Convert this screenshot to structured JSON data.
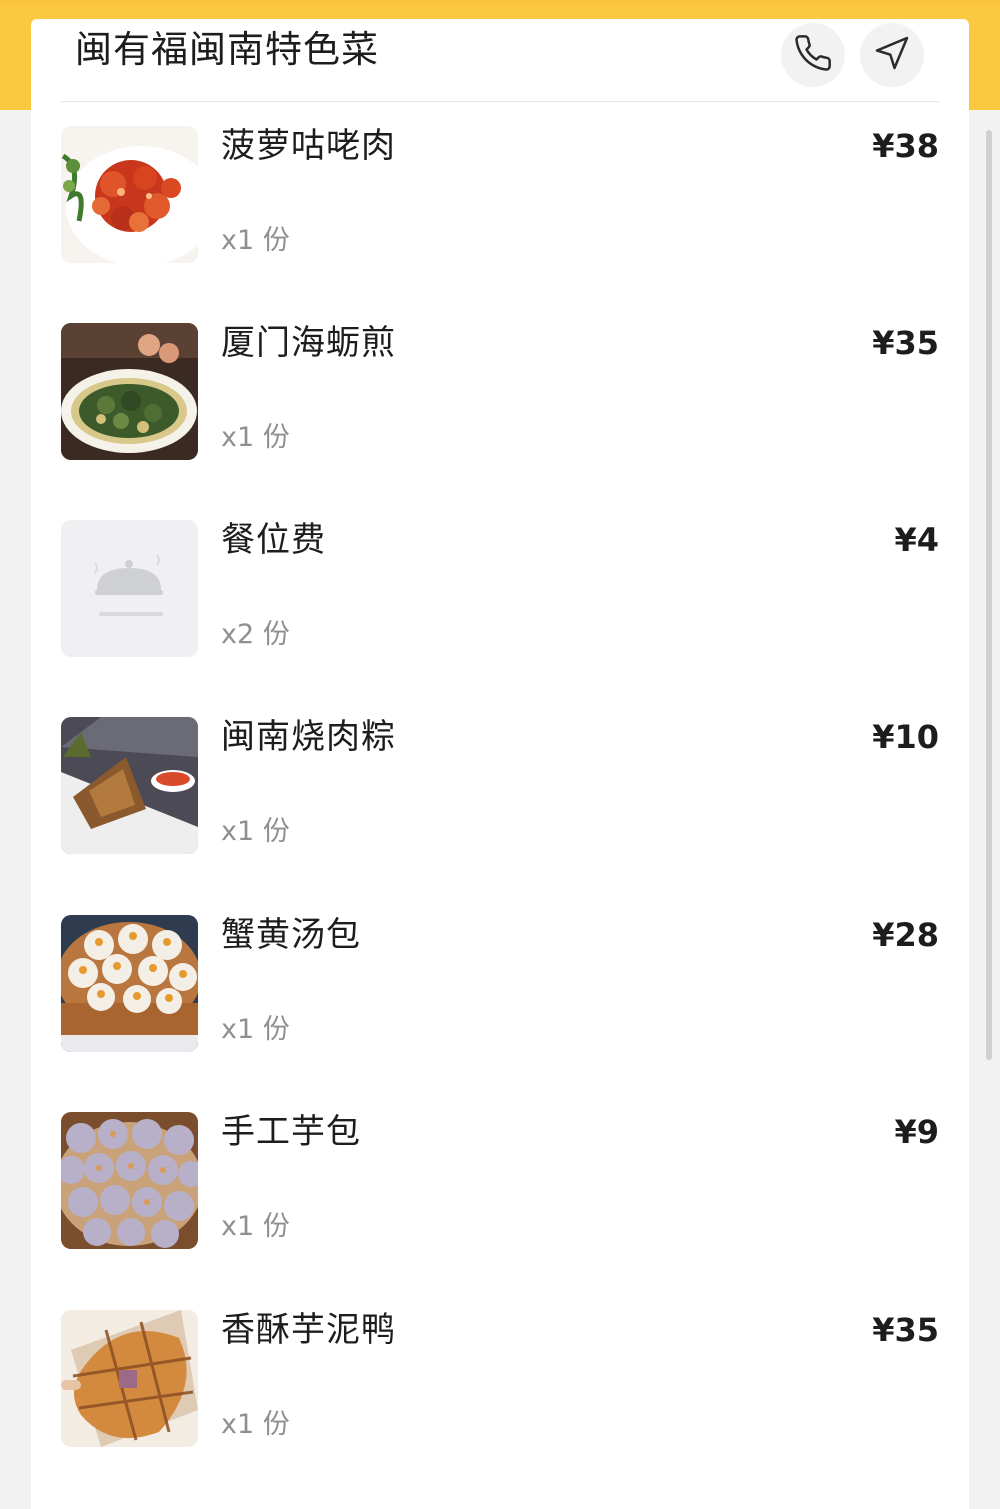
{
  "shop": {
    "name": "闽有福闽南特色菜"
  },
  "actions": {
    "phone_icon": "phone-icon",
    "navigate_icon": "navigation-arrow-icon"
  },
  "colors": {
    "accent": "#fbc93f",
    "background": "#f2f2f3",
    "text_primary": "#1d1d1f",
    "text_secondary": "#8e8e93"
  },
  "order_items": [
    {
      "name": "菠萝咕咾肉",
      "qty": "x1 份",
      "price": "¥38"
    },
    {
      "name": "厦门海蛎煎",
      "qty": "x1 份",
      "price": "¥35"
    },
    {
      "name": "餐位费",
      "qty": "x2 份",
      "price": "¥4"
    },
    {
      "name": "闽南烧肉粽",
      "qty": "x1 份",
      "price": "¥10"
    },
    {
      "name": "蟹黄汤包",
      "qty": "x1 份",
      "price": "¥28"
    },
    {
      "name": "手工芋包",
      "qty": "x1 份",
      "price": "¥9"
    },
    {
      "name": "香酥芋泥鸭",
      "qty": "x1 份",
      "price": "¥35"
    }
  ]
}
